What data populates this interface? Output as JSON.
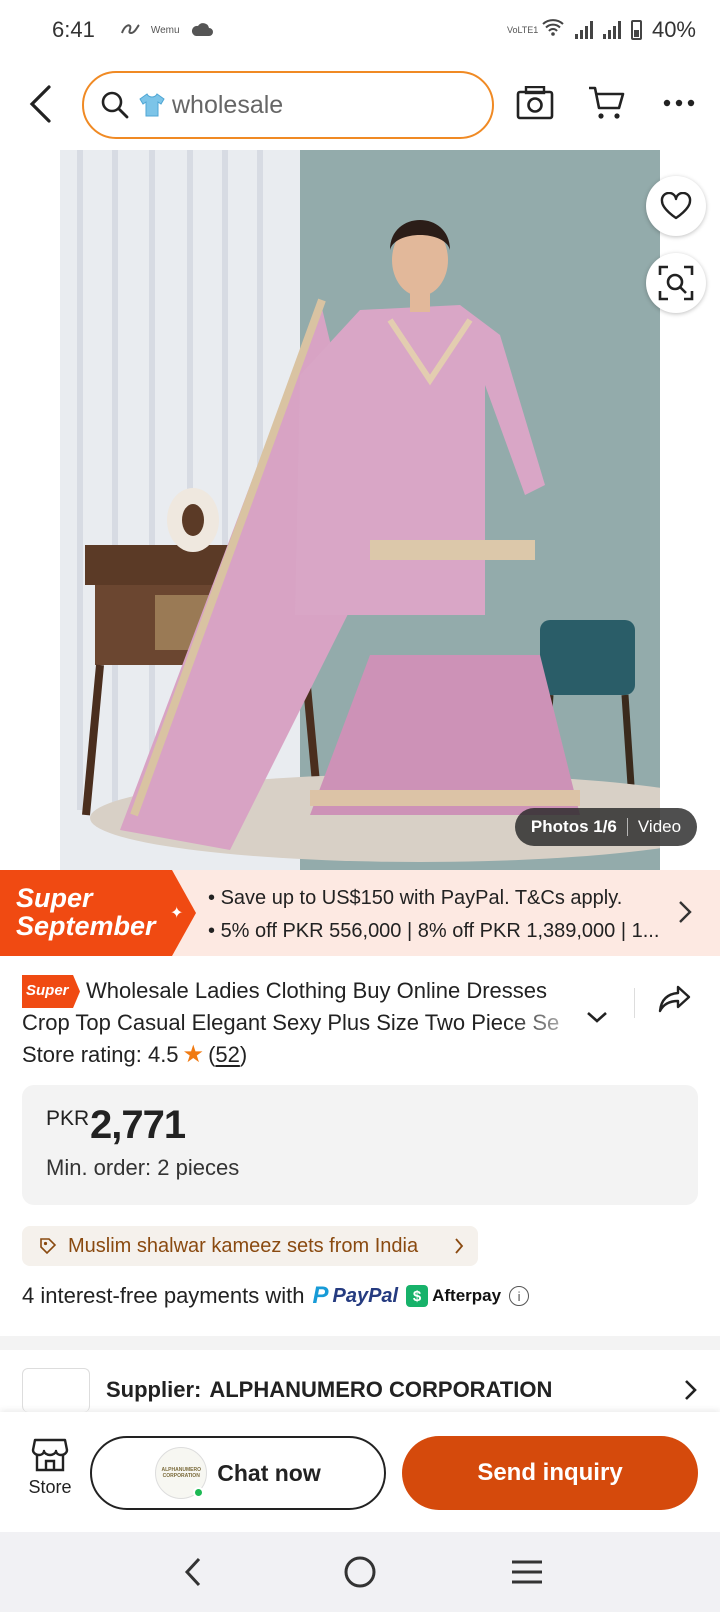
{
  "status": {
    "time": "6:41",
    "app_small": "Wemu",
    "lte": "VoLTE1",
    "battery": "40%"
  },
  "search": {
    "value": "wholesale"
  },
  "media": {
    "photos": "Photos 1/6",
    "video": "Video"
  },
  "promo": {
    "badge_line1": "Super",
    "badge_line2": "September",
    "line1": "Save up to US$150 with PayPal. T&Cs apply.",
    "line2": "5% off PKR 556,000 | 8% off PKR 1,389,000 | 1..."
  },
  "product": {
    "tag": "Super",
    "title_line1": "Wholesale Ladies Clothing Buy Online Dresses",
    "title_line2": "Crop Top Casual Elegant Sexy Plus Size Two Piece Se",
    "rating_label": "Store rating: 4.5",
    "rating_count": "52",
    "currency": "PKR",
    "price": "2,771",
    "min_order": "Min. order: 2 pieces",
    "category": "Muslim shalwar kameez sets from India",
    "payments_text": "4 interest-free payments with",
    "paypal": "PayPal",
    "afterpay": "Afterpay"
  },
  "supplier": {
    "label": "Supplier:",
    "name": "ALPHANUMERO CORPORATION"
  },
  "actions": {
    "store": "Store",
    "chat": "Chat now",
    "inquiry": "Send inquiry",
    "avatar_text": "ALPHANUMERO CORPORATION"
  },
  "colors": {
    "accent": "#d54a0c",
    "promo_orange": "#f04a12",
    "search_border": "#f08a24"
  }
}
